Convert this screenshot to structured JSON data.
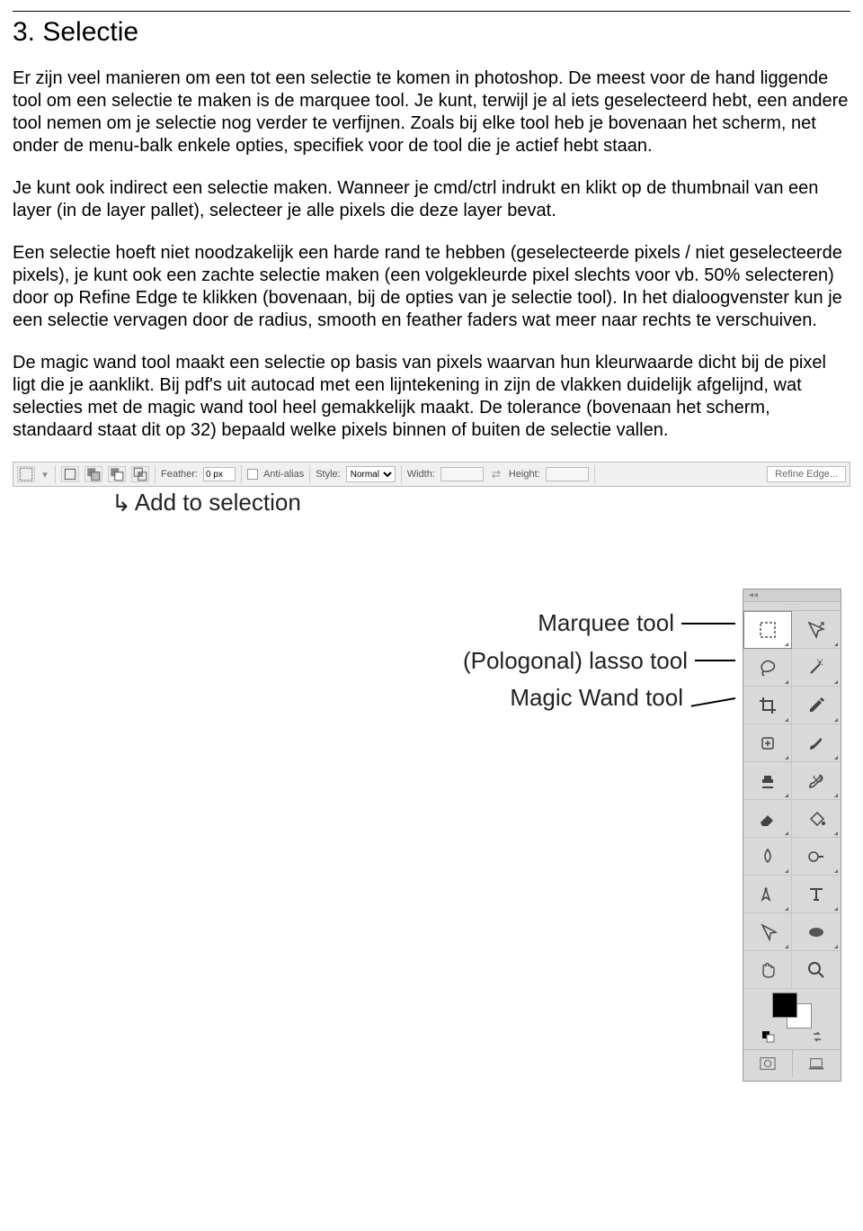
{
  "title": "3. Selectie",
  "paragraphs": {
    "p1": "Er zijn veel manieren om een tot een selectie te komen in photoshop. De meest voor de hand liggende tool om een selectie te maken is de marquee tool. Je kunt, terwijl je al iets geselecteerd hebt, een andere tool nemen om je selectie nog verder te verfijnen. Zoals bij elke tool heb je bovenaan het scherm, net onder de menu-balk enkele opties, specifiek voor de tool die je actief hebt staan.",
    "p2": "Je kunt ook indirect een selectie maken. Wanneer je cmd/ctrl indrukt en klikt op de thumbnail van een layer (in de layer pallet), selecteer je alle pixels die deze layer bevat.",
    "p3": "Een selectie hoeft niet noodzakelijk een harde rand te hebben (geselecteerde pixels / niet geselecteerde pixels), je kunt ook een zachte selectie maken (een volgekleurde pixel slechts voor vb. 50% selecteren) door op Refine Edge te klikken (bovenaan, bij de opties van je selectie tool). In het dialoogvenster kun je een selectie vervagen door de radius, smooth en feather faders wat meer naar rechts te verschuiven.",
    "p4": "De magic wand tool maakt een selectie op basis van pixels waarvan hun kleurwaarde dicht bij de pixel ligt die je aanklikt. Bij pdf's uit autocad met een lijntekening in zijn de vlakken duidelijk afgelijnd, wat selecties met de  magic wand tool heel gemakkelijk maakt. De tolerance (bovenaan het scherm, standaard staat dit op 32) bepaald welke pixels binnen of buiten de selectie vallen."
  },
  "options_bar": {
    "feather_label": "Feather:",
    "feather_value": "0 px",
    "antialias_label": "Anti-alias",
    "style_label": "Style:",
    "style_value": "Normal",
    "width_label": "Width:",
    "height_label": "Height:",
    "refine_label": "Refine Edge..."
  },
  "annotation_add": "Add to selection",
  "callouts": {
    "marquee": "Marquee tool",
    "lasso": "(Pologonal) lasso tool",
    "wand": "Magic Wand tool"
  },
  "tools": {
    "marquee": "marquee-tool",
    "move": "move-tool",
    "lasso": "lasso-tool",
    "wand": "magic-wand-tool",
    "crop": "crop-tool",
    "eyedropper": "eyedropper-tool",
    "heal": "healing-brush-tool",
    "brush": "brush-tool",
    "stamp": "clone-stamp-tool",
    "history": "history-brush-tool",
    "eraser": "eraser-tool",
    "bucket": "paint-bucket-tool",
    "blur": "blur-tool",
    "dodge": "dodge-tool",
    "pen": "pen-tool",
    "type": "type-tool",
    "path": "path-selection-tool",
    "shape": "shape-tool",
    "hand": "hand-tool",
    "zoom": "zoom-tool"
  }
}
